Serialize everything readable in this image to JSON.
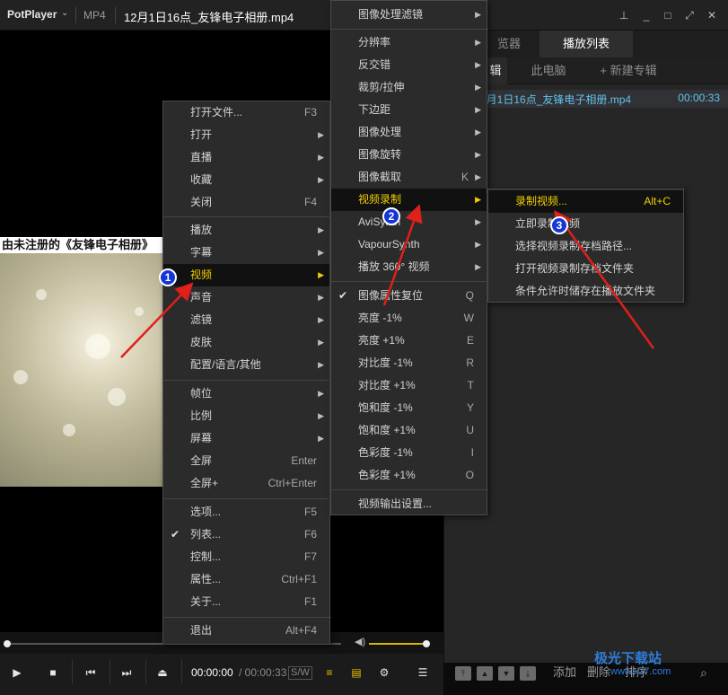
{
  "titlebar": {
    "brand": "PotPlayer",
    "format": "MP4",
    "title": "12月1日16点_友锋电子相册.mp4"
  },
  "video": {
    "caption": "由未注册的《友锋电子相册》"
  },
  "panel": {
    "tabs": [
      "览器",
      "播放列表"
    ],
    "subtabs": [
      "辑",
      "此电脑",
      "+ 新建专辑"
    ],
    "playlist": [
      {
        "name": "2月1日16点_友锋电子相册.mp4",
        "duration": "00:00:33"
      }
    ],
    "buttons": {
      "add": "添加",
      "delete": "删除",
      "sort": "排序"
    }
  },
  "controls": {
    "current_time": "00:00:00",
    "total_time": "/ 00:00:33",
    "sw": "S/W"
  },
  "menu1": {
    "items": [
      {
        "label": "打开文件...",
        "shortcut": "F3"
      },
      {
        "label": "打开",
        "sub": true
      },
      {
        "label": "直播",
        "sub": true
      },
      {
        "label": "收藏",
        "sub": true
      },
      {
        "label": "关闭",
        "shortcut": "F4"
      },
      {
        "label": "播放",
        "sub": true
      },
      {
        "label": "字幕",
        "sub": true
      },
      {
        "label": "视频",
        "sub": true,
        "highlighted": true
      },
      {
        "label": "声音",
        "sub": true
      },
      {
        "label": "滤镜",
        "sub": true
      },
      {
        "label": "皮肤",
        "sub": true
      },
      {
        "label": "配置/语言/其他",
        "sub": true
      },
      {
        "label": "帧位",
        "sub": true
      },
      {
        "label": "比例",
        "sub": true
      },
      {
        "label": "屏幕",
        "sub": true
      },
      {
        "label": "全屏",
        "shortcut": "Enter"
      },
      {
        "label": "全屏+",
        "shortcut": "Ctrl+Enter"
      },
      {
        "label": "选项...",
        "shortcut": "F5"
      },
      {
        "label": "列表...",
        "shortcut": "F6",
        "checked": true
      },
      {
        "label": "控制...",
        "shortcut": "F7"
      },
      {
        "label": "属性...",
        "shortcut": "Ctrl+F1"
      },
      {
        "label": "关于...",
        "shortcut": "F1"
      },
      {
        "label": "退出",
        "shortcut": "Alt+F4"
      }
    ]
  },
  "menu2": {
    "items": [
      {
        "label": "图像处理滤镜",
        "sub": true
      },
      {
        "label": "分辨率",
        "sub": true
      },
      {
        "label": "反交错",
        "sub": true
      },
      {
        "label": "裁剪/拉伸",
        "sub": true
      },
      {
        "label": "下边距",
        "sub": true
      },
      {
        "label": "图像处理",
        "sub": true
      },
      {
        "label": "图像旋转",
        "sub": true
      },
      {
        "label": "图像截取",
        "shortcut": "K",
        "sub": true
      },
      {
        "label": "视频录制",
        "sub": true,
        "highlighted": true
      },
      {
        "label": "AviSynth",
        "sub": true
      },
      {
        "label": "VapourSynth",
        "sub": true
      },
      {
        "label": "播放 360° 视频",
        "sub": true
      },
      {
        "label": "图像属性复位",
        "shortcut": "Q",
        "checked": true
      },
      {
        "label": "亮度 -1%",
        "shortcut": "W"
      },
      {
        "label": "亮度 +1%",
        "shortcut": "E"
      },
      {
        "label": "对比度 -1%",
        "shortcut": "R"
      },
      {
        "label": "对比度 +1%",
        "shortcut": "T"
      },
      {
        "label": "饱和度 -1%",
        "shortcut": "Y"
      },
      {
        "label": "饱和度 +1%",
        "shortcut": "U"
      },
      {
        "label": "色彩度 -1%",
        "shortcut": "I"
      },
      {
        "label": "色彩度 +1%",
        "shortcut": "O"
      },
      {
        "label": "视频输出设置..."
      }
    ]
  },
  "menu3": {
    "items": [
      {
        "label": "录制视频...",
        "shortcut": "Alt+C",
        "highlighted": true
      },
      {
        "label": "立即录制视频"
      },
      {
        "label": "选择视频录制存档路径..."
      },
      {
        "label": "打开视频录制存档文件夹"
      },
      {
        "label": "条件允许时储存在播放文件夹"
      }
    ]
  },
  "annotations": {
    "badges": [
      "1",
      "2",
      "3"
    ]
  },
  "watermark": {
    "line1": "极光下载站",
    "line2": "www.xz7.com"
  },
  "colors": {
    "highlight_text": "#f2d000",
    "badge": "#1435d8",
    "arrow": "#e0201a",
    "playlist_text": "#63c2ea"
  }
}
